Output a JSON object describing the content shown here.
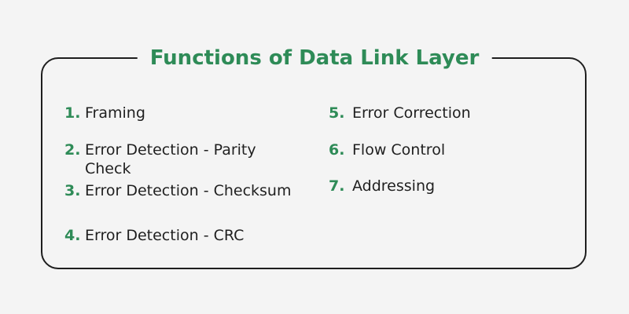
{
  "title": "Functions of Data Link Layer",
  "items": [
    {
      "number": "1.",
      "label": "Framing"
    },
    {
      "number": "2.",
      "label": "Error Detection - Parity Check"
    },
    {
      "number": "3.",
      "label": "Error Detection - Checksum"
    },
    {
      "number": "4.",
      "label": "Error Detection - CRC"
    },
    {
      "number": "5.",
      "label": "Error Correction"
    },
    {
      "number": "6.",
      "label": "Flow Control"
    },
    {
      "number": "7.",
      "label": "Addressing"
    }
  ],
  "colors": {
    "accent": "#2e8b57",
    "text": "#1f1f1f",
    "border": "#1e1e1e",
    "background": "#f4f4f4"
  }
}
